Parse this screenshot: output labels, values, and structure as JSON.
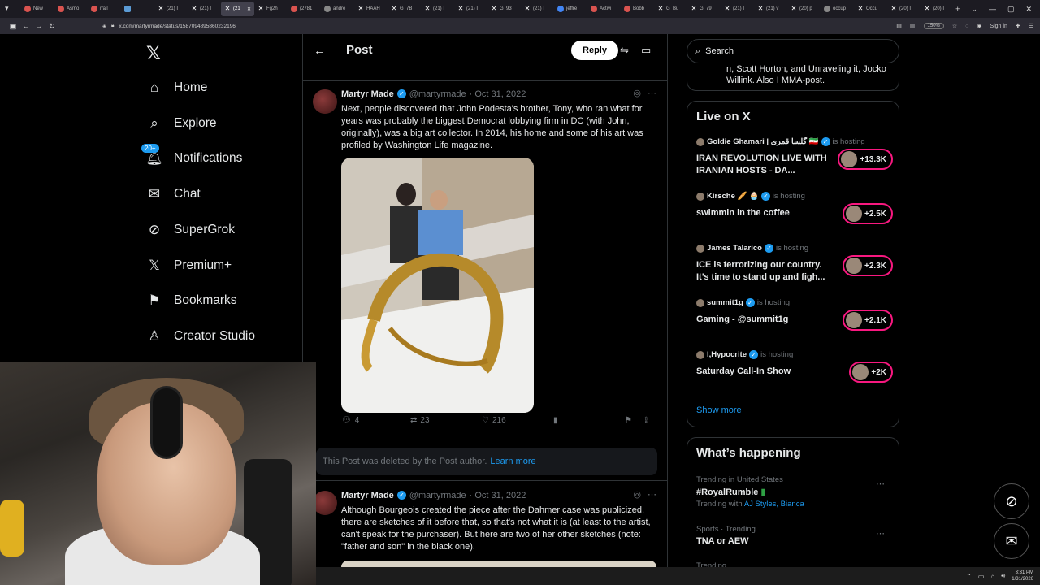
{
  "browser": {
    "tabs": [
      {
        "label": "New",
        "icon": "reddit-icon"
      },
      {
        "label": "Asmo",
        "icon": "reddit-icon"
      },
      {
        "label": "r/all",
        "icon": "reddit-icon"
      },
      {
        "label": "",
        "icon": "doc-icon"
      },
      {
        "label": "(21) I",
        "icon": "x-icon"
      },
      {
        "label": "(21) I",
        "icon": "x-icon"
      },
      {
        "label": "(21",
        "icon": "x-icon",
        "active": true
      },
      {
        "label": "Fg2h",
        "icon": "x-icon"
      },
      {
        "label": "(2781",
        "icon": "youtube-icon"
      },
      {
        "label": "andre",
        "icon": "globe-icon"
      },
      {
        "label": "HAAH",
        "icon": "x-icon"
      },
      {
        "label": "G_7B",
        "icon": "x-icon"
      },
      {
        "label": "(21) I",
        "icon": "x-icon"
      },
      {
        "label": "(21) I",
        "icon": "x-icon"
      },
      {
        "label": "G_93",
        "icon": "x-icon"
      },
      {
        "label": "(21) I",
        "icon": "x-icon"
      },
      {
        "label": "jeffre",
        "icon": "google-icon"
      },
      {
        "label": "Activi",
        "icon": "reddit-icon"
      },
      {
        "label": "Bobb",
        "icon": "reddit-icon"
      },
      {
        "label": "G_Bu",
        "icon": "x-icon"
      },
      {
        "label": "G_79",
        "icon": "x-icon"
      },
      {
        "label": "(21) I",
        "icon": "x-icon"
      },
      {
        "label": "(21) v",
        "icon": "x-icon"
      },
      {
        "label": "(20) p",
        "icon": "x-icon"
      },
      {
        "label": "occup",
        "icon": "globe-icon"
      },
      {
        "label": "Occu",
        "icon": "x-icon"
      },
      {
        "label": "(20) I",
        "icon": "x-icon"
      },
      {
        "label": "(20) I",
        "icon": "x-icon"
      },
      {
        "label": "(20) I",
        "icon": "x-icon"
      },
      {
        "label": "(20) I",
        "icon": "x-icon"
      },
      {
        "label": "(21",
        "icon": "x-icon"
      }
    ],
    "url": "x.com/martyrmade/status/1587094895860232196",
    "zoom": "150%",
    "sign_in": "Sign in"
  },
  "nav": {
    "items": [
      {
        "label": "Home",
        "icon": "home-icon"
      },
      {
        "label": "Explore",
        "icon": "search-icon"
      },
      {
        "label": "Notifications",
        "icon": "bell-icon",
        "badge": "20+"
      },
      {
        "label": "Chat",
        "icon": "mail-icon"
      },
      {
        "label": "SuperGrok",
        "icon": "grok-icon"
      },
      {
        "label": "Premium+",
        "icon": "x-icon"
      },
      {
        "label": "Bookmarks",
        "icon": "bookmark-icon"
      },
      {
        "label": "Creator Studio",
        "icon": "creator-icon"
      }
    ]
  },
  "post_header": {
    "title": "Post",
    "reply": "Reply"
  },
  "tweets": [
    {
      "name": "Martyr Made",
      "handle": "@martyrmade",
      "date": "· Oct 31, 2022",
      "text": "Next, people discovered that John Podesta's brother, Tony, who ran what for years was probably the biggest Democrat lobbying firm in DC (with John, originally), was a big art collector. In 2014, his home and some of his art was profiled by Washington Life magazine.",
      "replies": "4",
      "reposts": "23",
      "likes": "216"
    },
    {
      "name": "Martyr Made",
      "handle": "@martyrmade",
      "date": "· Oct 31, 2022",
      "text": "Although Bourgeois created the piece after the Dahmer case was publicized, there are sketches of it before that, so that's not what it is (at least to the artist, can't speak for the purchaser). But here are two of her other sketches (note: \"father and son\" in the black one)."
    }
  ],
  "deleted": {
    "text": "This Post was deleted by the Post author.",
    "link": "Learn more"
  },
  "sidebar": {
    "search_placeholder": "Search",
    "prev_card": "n, Scott Horton, and Unraveling it, Jocko Willink. Also I MMA-post.",
    "live": {
      "title": "Live on X",
      "items": [
        {
          "host": "Goldie Ghamari | گلسا قمری 🇮🇷",
          "status": "is hosting",
          "title": "IRAN REVOLUTION LIVE WITH IRANIAN HOSTS - DA...",
          "count": "+13.3K"
        },
        {
          "host": "Kirsche 🥖 🧁",
          "status": "is hosting",
          "title": "swimmin in the coffee",
          "count": "+2.5K"
        },
        {
          "host": "James Talarico",
          "status": "is hosting",
          "title": "ICE is terrorizing our country. It’s time to stand up and figh...",
          "count": "+2.3K"
        },
        {
          "host": "summit1g",
          "status": "is hosting",
          "title": "Gaming - @summit1g",
          "count": "+2.1K"
        },
        {
          "host": "I,Hypocrite",
          "status": "is hosting",
          "title": "Saturday Call-In Show",
          "count": "+2K"
        }
      ],
      "show_more": "Show more"
    },
    "happening": {
      "title": "What’s happening",
      "trends": [
        {
          "meta": "Trending in United States",
          "name": "#RoyalRumble",
          "with_label": "Trending with",
          "with": "AJ Styles, Bianca"
        },
        {
          "meta": "Sports · Trending",
          "name": "TNA or AEW"
        },
        {
          "meta": "Trending"
        }
      ]
    }
  },
  "taskbar": {
    "time": "3:31 PM",
    "date": "1/31/2026"
  }
}
